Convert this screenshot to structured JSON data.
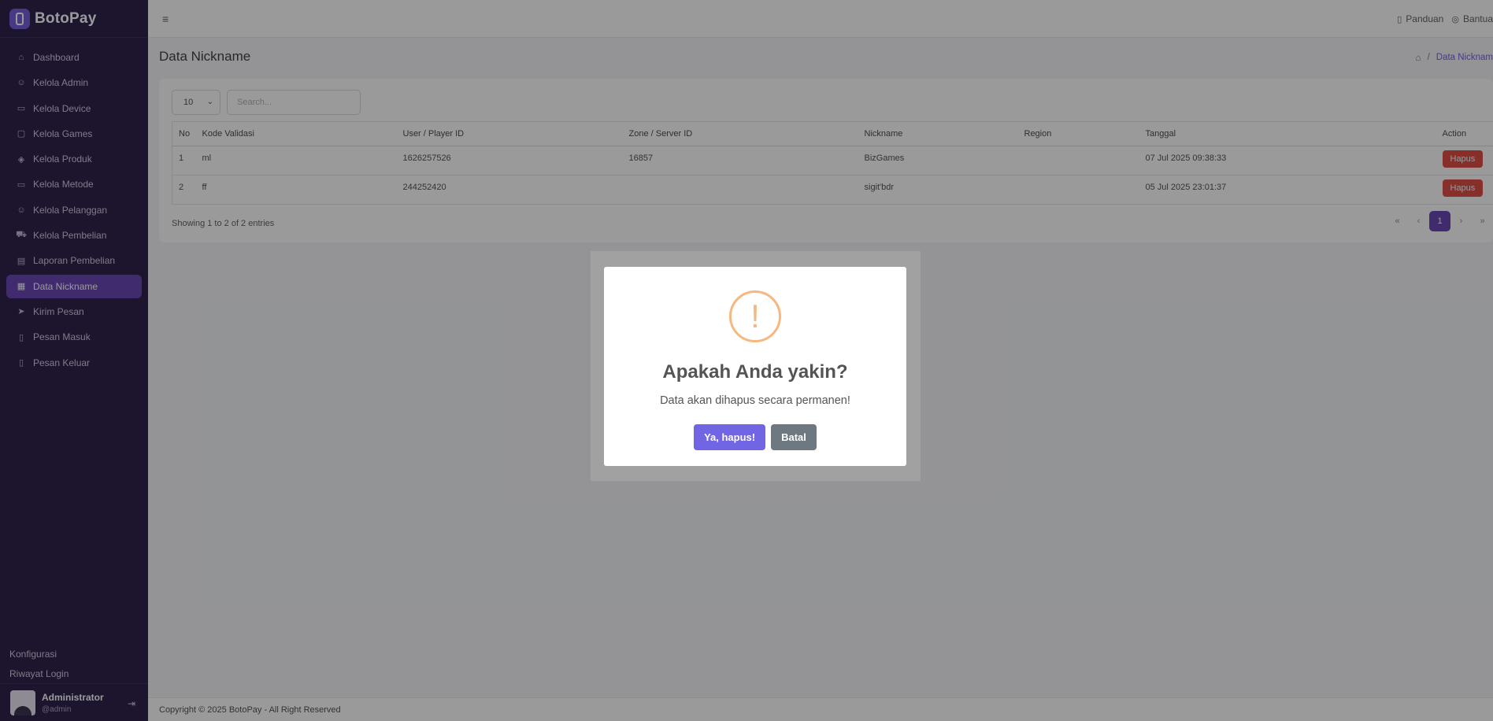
{
  "brand": {
    "name": "BotoPay"
  },
  "sidebar": {
    "items": [
      {
        "label": "Dashboard",
        "icon": "home-icon"
      },
      {
        "label": "Kelola Admin",
        "icon": "user-icon"
      },
      {
        "label": "Kelola Device",
        "icon": "devices-icon"
      },
      {
        "label": "Kelola Games",
        "icon": "gamepad-icon"
      },
      {
        "label": "Kelola Produk",
        "icon": "box-icon"
      },
      {
        "label": "Kelola Metode",
        "icon": "credit-card-icon"
      },
      {
        "label": "Kelola Pelanggan",
        "icon": "user-icon"
      },
      {
        "label": "Kelola Pembelian",
        "icon": "cart-icon"
      },
      {
        "label": "Laporan Pembelian",
        "icon": "report-icon"
      },
      {
        "label": "Data Nickname",
        "icon": "database-icon",
        "active": true
      },
      {
        "label": "Kirim Pesan",
        "icon": "send-icon"
      },
      {
        "label": "Pesan Masuk",
        "icon": "message-icon"
      },
      {
        "label": "Pesan Keluar",
        "icon": "message-icon"
      }
    ],
    "bottom_links": [
      "Konfigurasi",
      "Riwayat Login"
    ],
    "user": {
      "name": "Administrator",
      "handle": "@admin"
    }
  },
  "header": {
    "links": [
      {
        "label": "Panduan",
        "icon": "book-icon"
      },
      {
        "label": "Bantua",
        "icon": "help-icon"
      }
    ]
  },
  "page": {
    "title": "Data Nickname",
    "breadcrumb_current": "Data Nicknam"
  },
  "table": {
    "length_value": "10",
    "search_placeholder": "Search...",
    "columns": [
      "No",
      "Kode Validasi",
      "User / Player ID",
      "Zone / Server ID",
      "Nickname",
      "Region",
      "Tanggal",
      "Action"
    ],
    "rows": [
      {
        "no": "1",
        "kode": "ml",
        "user_id": "1626257526",
        "zone_id": "16857",
        "nickname": "BizGames",
        "region": "",
        "tanggal": "07 Jul 2025 09:38:33",
        "action": "Hapus"
      },
      {
        "no": "2",
        "kode": "ff",
        "user_id": "244252420",
        "zone_id": "",
        "nickname": "sigit'bdr",
        "region": "",
        "tanggal": "05 Jul 2025 23:01:37",
        "action": "Hapus"
      }
    ],
    "info": "Showing 1 to 2 of 2 entries",
    "pager": {
      "first": "«",
      "prev": "‹",
      "current": "1",
      "next": "›",
      "last": "»"
    }
  },
  "footer": {
    "text": "Copyright © 2025 BotoPay - All Right Reserved"
  },
  "modal": {
    "icon_glyph": "!",
    "title": "Apakah Anda yakin?",
    "text": "Data akan dihapus secara permanen!",
    "confirm_label": "Ya, hapus!",
    "cancel_label": "Batal"
  },
  "colors": {
    "sidebar_bg": "#1c0b3b",
    "accent": "#5a36b0",
    "danger": "#dc3d36",
    "confirm": "#7165e3",
    "warning": "#f5b880"
  }
}
